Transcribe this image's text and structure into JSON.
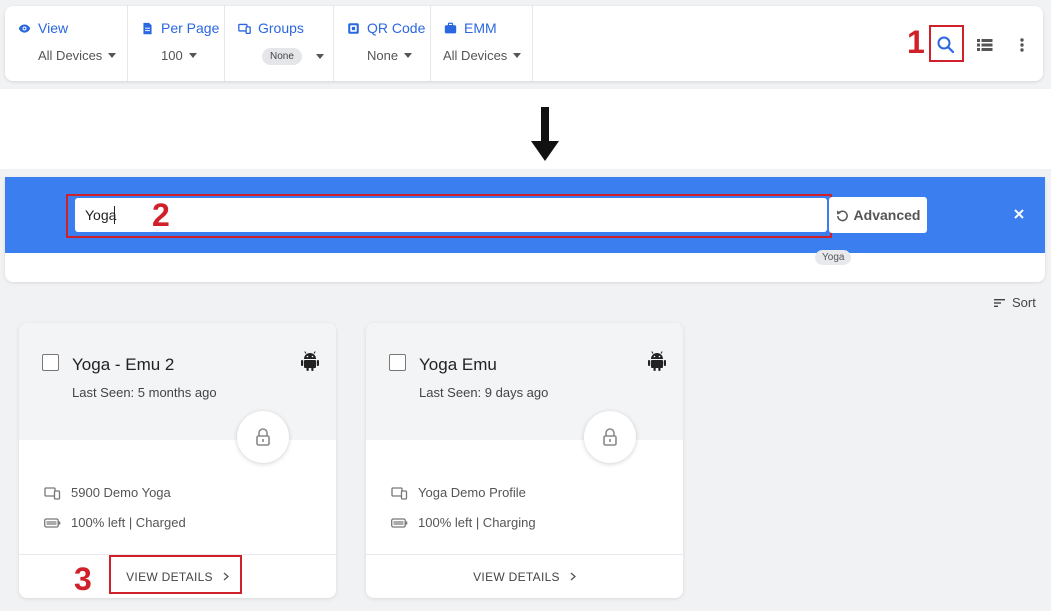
{
  "toolbar": {
    "filters": [
      {
        "title": "View",
        "value": "All Devices",
        "icon": "eye-icon"
      },
      {
        "title": "Per Page",
        "value": "100",
        "icon": "document-icon"
      },
      {
        "title": "Groups",
        "value": "None",
        "icon": "devices-icon"
      },
      {
        "title": "QR Code",
        "value": "None",
        "icon": "qr-code-icon"
      },
      {
        "title": "EMM",
        "value": "All Devices",
        "icon": "briefcase-icon"
      }
    ],
    "actions": [
      "search-icon",
      "list-view-icon",
      "more-vertical-icon"
    ]
  },
  "annotations": {
    "step1": "1",
    "step2": "2",
    "step3": "3"
  },
  "search": {
    "value": "Yoga",
    "advanced_label": "Advanced",
    "chip": "Yoga"
  },
  "sort_label": "Sort",
  "devices": [
    {
      "name": "Yoga - Emu 2",
      "last_seen": "Last Seen: 5 months ago",
      "profile": "5900 Demo Yoga",
      "battery": "100% left | Charged",
      "details_label": "VIEW DETAILS",
      "os_icon": "android-icon"
    },
    {
      "name": "Yoga Emu",
      "last_seen": "Last Seen: 9 days ago",
      "profile": "Yoga Demo Profile",
      "battery": "100% left | Charging",
      "details_label": "VIEW DETAILS",
      "os_icon": "android-icon"
    }
  ],
  "colors": {
    "accent": "#2a67e0",
    "search_bar": "#3a7ef0",
    "highlight": "#d0202a"
  }
}
